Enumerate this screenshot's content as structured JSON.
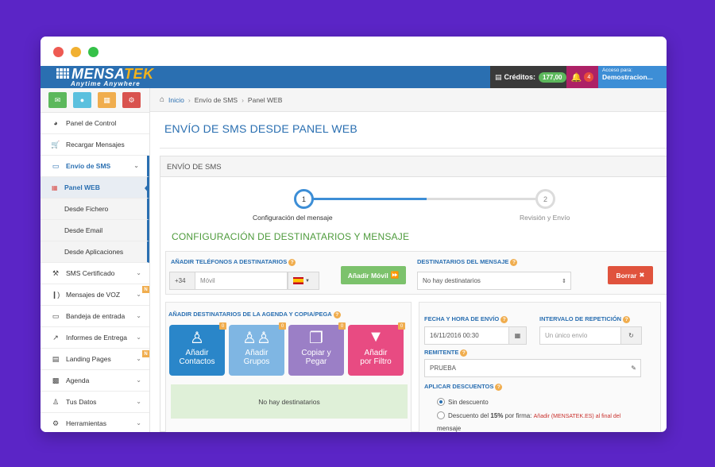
{
  "topbar": {
    "logo_main": "MENSA",
    "logo_accent": "TEK",
    "logo_tagline": "Anytime Anywhere",
    "credits_label": "Créditos:",
    "credits_value": "177,00",
    "notifications_count": "4",
    "access_label": "Acceso para:",
    "access_user": "Demostracion..."
  },
  "sidebar": {
    "quick_buttons": [
      {
        "icon": "envelope-icon",
        "color": "#5cb85c"
      },
      {
        "icon": "circle-icon",
        "color": "#5bc0de"
      },
      {
        "icon": "gift-icon",
        "color": "#f0ad4e"
      },
      {
        "icon": "users-cog-icon",
        "color": "#d9534f"
      }
    ],
    "items": [
      {
        "label": "Panel de Control"
      },
      {
        "label": "Recargar Mensajes"
      },
      {
        "label": "Envío de SMS"
      },
      {
        "label": "SMS Certificado"
      },
      {
        "label": "Mensajes de VOZ",
        "badge": "N"
      },
      {
        "label": "Bandeja de entrada"
      },
      {
        "label": "Informes de Entrega"
      },
      {
        "label": "Landing Pages",
        "badge": "N"
      },
      {
        "label": "Agenda"
      },
      {
        "label": "Tus Datos"
      },
      {
        "label": "Herramientas"
      }
    ],
    "sub_items": [
      "Panel WEB",
      "Desde Fichero",
      "Desde Email",
      "Desde Aplicaciones"
    ]
  },
  "breadcrumb": [
    "Inicio",
    "Envío de SMS",
    "Panel WEB"
  ],
  "page_title": "ENVÍO DE SMS DESDE PANEL WEB",
  "panel_title": "ENVÍO DE SMS",
  "steps": [
    {
      "number": "1",
      "label": "Configuración del mensaje"
    },
    {
      "number": "2",
      "label": "Revisión y Envío"
    }
  ],
  "section_title": "CONFIGURACIÓN DE DESTINATARIOS Y MENSAJE",
  "phones": {
    "label": "AÑADIR TELÉFONOS A DESTINATARIOS",
    "prefix": "+34",
    "placeholder": "Móvil",
    "add_button": "Añadir Móvil",
    "dest_label": "DESTINATARIOS DEL MENSAJE",
    "dest_value": "No hay destinatarios",
    "delete_button": "Borrar"
  },
  "agenda": {
    "label": "AÑADIR DESTINATARIOS DE LA AGENDA Y COPIA/PEGA",
    "tiles": [
      {
        "line1": "Añadir",
        "line2": "Contactos",
        "count": "0",
        "color": "#2a86c9"
      },
      {
        "line1": "Añadir",
        "line2": "Grupos",
        "count": "0",
        "color": "#7fb6e3"
      },
      {
        "line1": "Copiar y",
        "line2": "Pegar",
        "count": "0",
        "color": "#9b7fc6"
      },
      {
        "line1": "Añadir",
        "line2": "por Filtro",
        "count": "0",
        "color": "#e84b82"
      }
    ],
    "empty_text": "No hay destinatarios"
  },
  "schedule": {
    "date_label": "FECHA Y HORA DE ENVÍO",
    "date_value": "16/11/2016 00:30",
    "interval_label": "INTERVALO DE REPETICIÓN",
    "interval_placeholder": "Un único envío",
    "sender_label": "REMITENTE",
    "sender_value": "PRUEBA",
    "discount_label": "APLICAR DESCUENTOS",
    "option1": "Sin descuento",
    "option2_pre": "Descuento del ",
    "option2_bold": "15%",
    "option2_post": " por firma:",
    "option2_red": "Añadir (MENSATEK.ES) al final del",
    "option2_cont": "mensaje"
  }
}
